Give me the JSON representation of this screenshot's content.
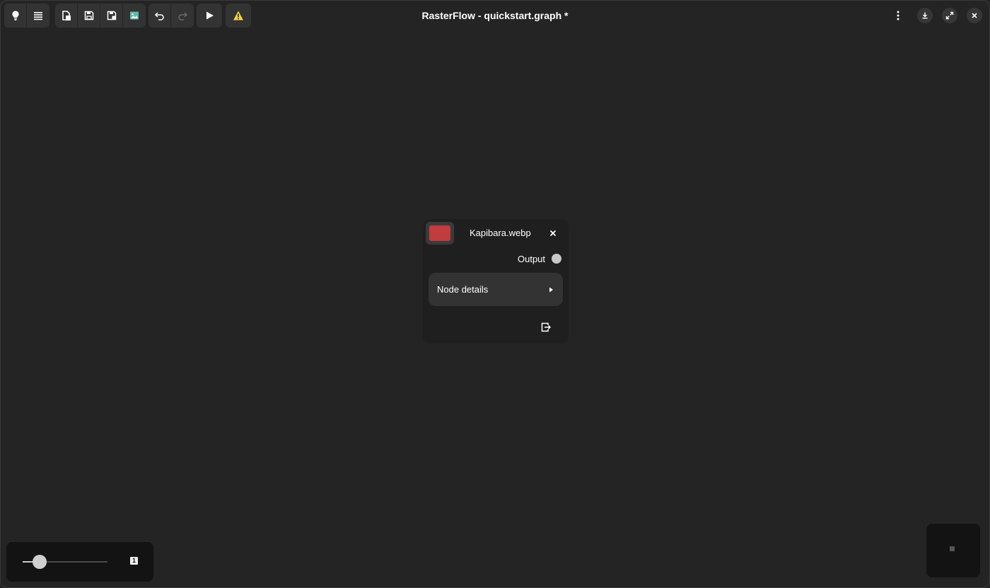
{
  "window": {
    "title": "RasterFlow - quickstart.graph *"
  },
  "toolbar": {
    "groups": [
      {
        "buttons": [
          {
            "icon": "lightbulb-icon"
          },
          {
            "icon": "list-icon"
          }
        ]
      },
      {
        "buttons": [
          {
            "icon": "new-file-icon"
          },
          {
            "icon": "save-icon"
          },
          {
            "icon": "save-as-icon"
          },
          {
            "icon": "image-icon"
          }
        ]
      },
      {
        "buttons": [
          {
            "icon": "undo-icon"
          },
          {
            "icon": "redo-icon"
          }
        ]
      },
      {
        "buttons": [
          {
            "icon": "play-icon"
          }
        ]
      },
      {
        "buttons": [
          {
            "icon": "warning-icon"
          }
        ]
      }
    ],
    "menu_icon": "kebab-menu-icon",
    "window_controls": [
      "download-icon",
      "expand-icon",
      "close-icon"
    ]
  },
  "colors": {
    "canvas_bg": "#242424",
    "node_bg": "#1f1f1f",
    "node_swatch": "#c13c3f",
    "image_icon": "#5fb8a8",
    "warning": "#f5d33c"
  },
  "node": {
    "title": "Kapibara.webp",
    "swatch_color": "#c13c3f",
    "output_label": "Output",
    "details_label": "Node details"
  },
  "zoom": {
    "level": 0.2,
    "badge": "1"
  }
}
